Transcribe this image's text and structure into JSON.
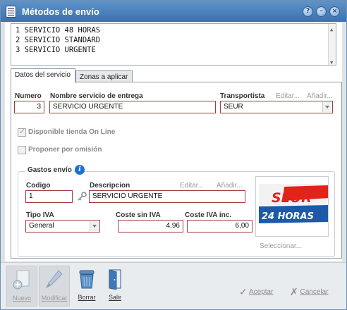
{
  "window": {
    "title": "Métodos de envío"
  },
  "title_buttons": {
    "help": "?",
    "minimize": "–",
    "close": "×"
  },
  "services": [
    "1 SERVICIO 48 HORAS",
    "2 SERVICIO STANDARD",
    "3 SERVICIO URGENTE"
  ],
  "tabs": [
    {
      "label": "Datos del servicio",
      "active": true
    },
    {
      "label": "Zonas a aplicar",
      "active": false
    }
  ],
  "service_form": {
    "numero_label": "Numero",
    "numero_value": "3",
    "nombre_label": "Nombre servicio de entrega",
    "nombre_value": "SERVICIO URGENTE",
    "transportista_label": "Transportista",
    "editar_link": "Editar...",
    "anadir_link": "Añadir...",
    "transportista_value": "SEUR",
    "disponible_label": "Disponible tienda On Line",
    "disponible_checked": true,
    "proponer_label": "Proponer por omisión",
    "proponer_checked": false
  },
  "gastos": {
    "group_title": "Gastos envío",
    "info_icon": "i",
    "codigo_label": "Codigo",
    "codigo_value": "1",
    "descripcion_label": "Descripcion",
    "editar_link": "Editar...",
    "anadir_link": "Añadir...",
    "descripcion_value": "SERVICIO URGENTE",
    "tipo_iva_label": "Tipo IVA",
    "tipo_iva_value": "General",
    "coste_sin_iva_label": "Coste sin IVA",
    "coste_sin_iva_value": "4,96",
    "coste_iva_inc_label": "Coste IVA inc.",
    "coste_iva_inc_value": "6,00",
    "logo_brand": "SEUR",
    "logo_caption": "24 HORAS",
    "seleccionar_link": "Seleccionar..."
  },
  "toolbar": {
    "nuevo": "Nuevo",
    "modificar": "Modificar",
    "borrar": "Borrar",
    "salir": "Salir",
    "aceptar": "Aceptar",
    "cancelar": "Cancelar"
  },
  "colors": {
    "title_bar": "#3a72b0",
    "field_border": "#a23c3c",
    "seur_red": "#e2231a",
    "seur_blue": "#1c5aa8",
    "info_blue": "#1e6fd1"
  }
}
